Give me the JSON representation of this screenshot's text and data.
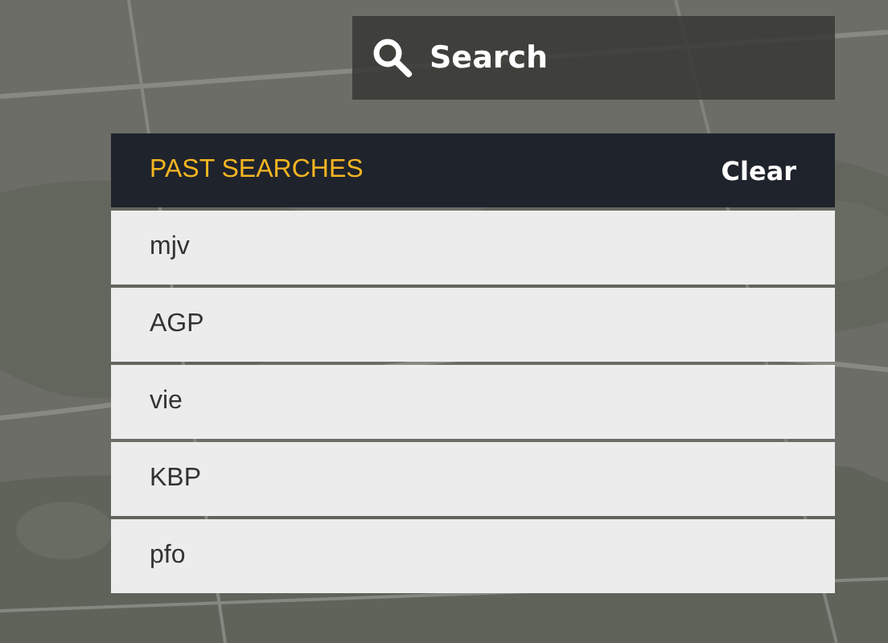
{
  "search": {
    "placeholder": "Search"
  },
  "past_searches": {
    "title": "PAST SEARCHES",
    "clear": "Clear",
    "items": [
      {
        "label": "mjv"
      },
      {
        "label": "AGP"
      },
      {
        "label": "vie"
      },
      {
        "label": "KBP"
      },
      {
        "label": "pfo"
      }
    ]
  }
}
